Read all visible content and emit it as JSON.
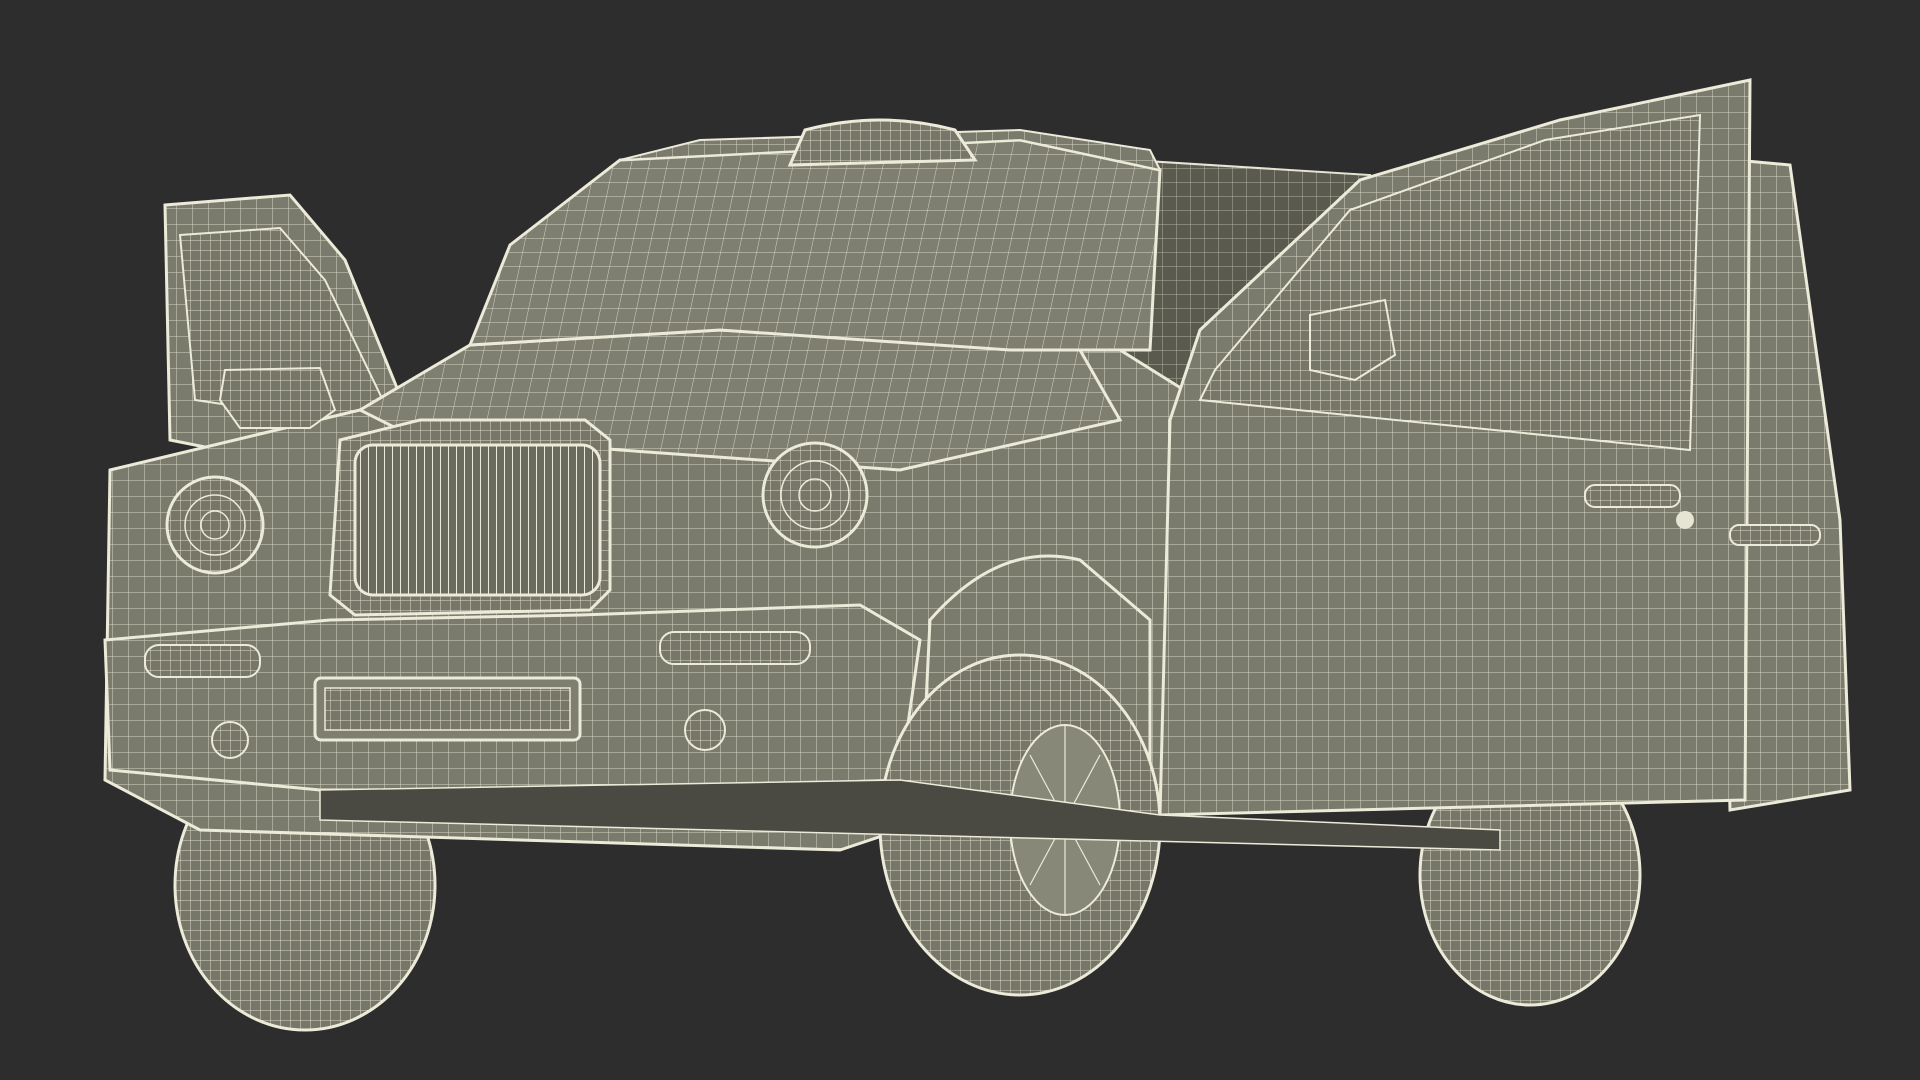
{
  "scene": {
    "subject": "wireframe-taxi-3d-model",
    "background_color": "#2d2d2d",
    "body_color": "#7d7d6f",
    "wire_color": "#e4e2cf"
  }
}
